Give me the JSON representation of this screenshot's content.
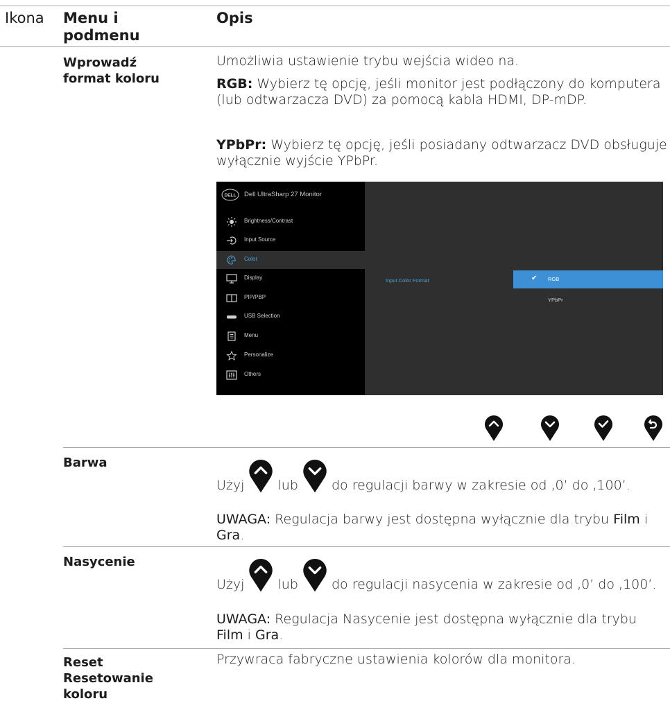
{
  "header": {
    "col_icon": "Ikona",
    "col_menu": "Menu i podmenu",
    "col_desc": "Opis"
  },
  "rows": [
    {
      "menu": "Wprowadź format koloru",
      "intro": "Umożliwia ustawienie trybu wejścia wideo na.",
      "rgb_label": "RGB:",
      "rgb_text": "Wybierz tę opcję, jeśli monitor jest podłączony do komputera (lub odtwarzacza DVD) za pomocą kabla HDMI, DP-mDP.",
      "ypbpr_label": "YPbPr:",
      "ypbpr_text": "Wybierz tę opcję, jeśli posiadany odtwarzacz DVD obsługuje wyłącznie wyjście YPbPr."
    },
    {
      "menu": "Barwa",
      "use": "Użyj",
      "or": "lub",
      "desc_rest": "do regulacji barwy w zakresie od ‚0’ do ‚100’.",
      "note_label": "UWAGA:",
      "note_text": "Regulacja barwy jest dostępna wyłącznie dla trybu",
      "film": "Film",
      "and": "i",
      "game": "Gra",
      "end": "."
    },
    {
      "menu": "Nasycenie",
      "use": "Użyj",
      "or": "lub",
      "desc_rest": "do regulacji nasycenia w zakresie od ‚0’ do ‚100’.",
      "note_label": "UWAGA:",
      "note_text": "Regulacja Nasycenie jest dostępna wyłącznie dla trybu",
      "film": "Film",
      "and": "i",
      "game": "Gra",
      "end": "."
    },
    {
      "menu": "Reset Resetowanie koloru",
      "desc": "Przywraca fabryczne ustawienia kolorów dla monitora."
    }
  ],
  "osd": {
    "logo": "DELL",
    "title": "Dell UltraSharp 27 Monitor",
    "items": [
      {
        "label": "Brightness/Contrast",
        "icon": "brightness-icon"
      },
      {
        "label": "Input Source",
        "icon": "input-source-icon"
      },
      {
        "label": "Color",
        "icon": "color-palette-icon",
        "selected": true
      },
      {
        "label": "Display",
        "icon": "display-icon"
      },
      {
        "label": "PIP/PBP",
        "icon": "pip-pbp-icon"
      },
      {
        "label": "USB Selection",
        "icon": "usb-icon"
      },
      {
        "label": "Menu",
        "icon": "menu-icon"
      },
      {
        "label": "Personalize",
        "icon": "star-icon"
      },
      {
        "label": "Others",
        "icon": "others-icon"
      }
    ],
    "submenu_label": "Input Color Format",
    "options": [
      {
        "label": "RGB",
        "selected": true
      },
      {
        "label": "YPbPr",
        "selected": false
      }
    ],
    "accent": "#3d8fd6",
    "text_accent": "#4aa3df"
  },
  "buttons": [
    "up-icon",
    "down-icon",
    "ok-icon",
    "back-icon"
  ]
}
